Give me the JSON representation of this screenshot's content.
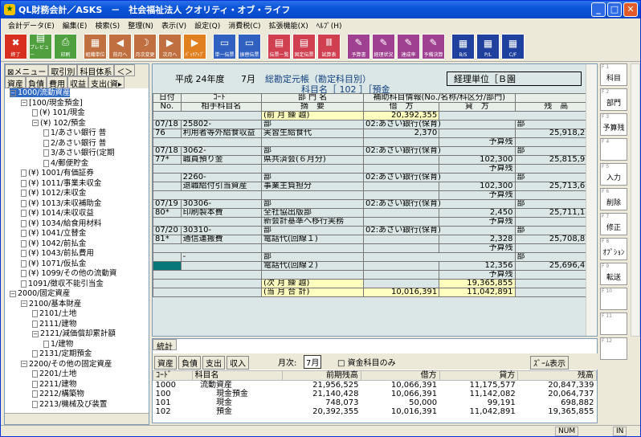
{
  "window": {
    "title": "QL財務会計／ASKS　－　社会福祉法人 クオリティ・オブ・ライフ"
  },
  "menu": [
    "会計データ(E)",
    "編集(E)",
    "検索(S)",
    "整理(N)",
    "表示(V)",
    "設定(Q)",
    "消費税(C)",
    "拡張機能(X)",
    "ﾍﾙﾌﾟ(H)"
  ],
  "toolbar": [
    {
      "label": "終了",
      "color": "#d83020",
      "icon": "exit-icon",
      "glyph": "✖"
    },
    {
      "label": "プレビュー",
      "color": "#50a040",
      "icon": "preview-icon",
      "glyph": "▤"
    },
    {
      "label": "印刷",
      "color": "#50a040",
      "icon": "print-icon",
      "glyph": "⎙"
    },
    {
      "label": "組織単位",
      "color": "#c07040",
      "icon": "org-icon",
      "glyph": "▦"
    },
    {
      "label": "前月へ",
      "color": "#c07040",
      "icon": "prev-month-icon",
      "glyph": "◀"
    },
    {
      "label": "月次変更",
      "color": "#c07040",
      "icon": "month-change-icon",
      "glyph": "☽"
    },
    {
      "label": "次月へ",
      "color": "#c07040",
      "icon": "next-month-icon",
      "glyph": "▶"
    },
    {
      "label": "ﾊﾞｯｸｱｯﾌﾟ",
      "color": "#e08020",
      "icon": "backup-icon",
      "glyph": "▶"
    },
    {
      "label": "単一伝票",
      "color": "#3060c0",
      "icon": "single-slip-icon",
      "glyph": "▭"
    },
    {
      "label": "振替伝票",
      "color": "#3060c0",
      "icon": "transfer-slip-icon",
      "glyph": "▭"
    },
    {
      "label": "伝票一覧",
      "color": "#d04050",
      "icon": "slip-list-icon",
      "glyph": "▤"
    },
    {
      "label": "固定伝票",
      "color": "#d04050",
      "icon": "fixed-slip-icon",
      "glyph": "▤"
    },
    {
      "label": "試算表",
      "color": "#d04050",
      "icon": "trial-balance-icon",
      "glyph": "Ⅲ"
    },
    {
      "label": "予算書",
      "color": "#a04090",
      "icon": "budget-icon",
      "glyph": "✎"
    },
    {
      "label": "経理状況",
      "color": "#a04090",
      "icon": "accounting-status-icon",
      "glyph": "✎"
    },
    {
      "label": "達成率",
      "color": "#a04090",
      "icon": "achievement-icon",
      "glyph": "✎"
    },
    {
      "label": "予備決算",
      "color": "#a04090",
      "icon": "pre-settlement-icon",
      "glyph": "✎"
    },
    {
      "label": "B/S",
      "color": "#2040a0",
      "icon": "bs-icon",
      "glyph": "▦"
    },
    {
      "label": "P/L",
      "color": "#2040a0",
      "icon": "pl-icon",
      "glyph": "▦"
    },
    {
      "label": "C/F",
      "color": "#2040a0",
      "icon": "cf-icon",
      "glyph": "▦"
    }
  ],
  "left_tabs": {
    "row1": [
      "⊠メニュー",
      "取引別",
      "科目体系",
      "＜＞"
    ],
    "row2": [
      "資産",
      "負債",
      "費用",
      "収益",
      "支出(資▸"
    ]
  },
  "tree": [
    {
      "t": "1000/流動資産",
      "d": 0,
      "k": "box",
      "s": true
    },
    {
      "t": "[100/現金預金]",
      "d": 1,
      "k": "box"
    },
    {
      "t": "(¥) 101/現金",
      "d": 2,
      "k": "doc"
    },
    {
      "t": "(¥) 102/預金",
      "d": 2,
      "k": "box"
    },
    {
      "t": "1/あさい銀行 普",
      "d": 3,
      "k": "doc"
    },
    {
      "t": "2/あさい銀行 普",
      "d": 3,
      "k": "doc"
    },
    {
      "t": "3/あさい銀行(定期",
      "d": 3,
      "k": "doc"
    },
    {
      "t": "4/郵便貯金",
      "d": 3,
      "k": "doc"
    },
    {
      "t": "(¥) 1001/有価証券",
      "d": 1,
      "k": "doc"
    },
    {
      "t": "(¥) 1011/事業未収金",
      "d": 1,
      "k": "doc"
    },
    {
      "t": "(¥) 1012/未収金",
      "d": 1,
      "k": "doc"
    },
    {
      "t": "(¥) 1013/未収補助金",
      "d": 1,
      "k": "doc"
    },
    {
      "t": "(¥) 1014/未収収益",
      "d": 1,
      "k": "doc"
    },
    {
      "t": "(¥) 1034/給食用材料",
      "d": 1,
      "k": "doc"
    },
    {
      "t": "(¥) 1041/立替金",
      "d": 1,
      "k": "doc"
    },
    {
      "t": "(¥) 1042/前払金",
      "d": 1,
      "k": "doc"
    },
    {
      "t": "(¥) 1043/前払費用",
      "d": 1,
      "k": "doc"
    },
    {
      "t": "(¥) 1071/仮払金",
      "d": 1,
      "k": "doc"
    },
    {
      "t": "(¥) 1099/その他の流動資",
      "d": 1,
      "k": "doc"
    },
    {
      "t": "1091/徴収不能引当金",
      "d": 1,
      "k": "doc"
    },
    {
      "t": "2000/固定資産",
      "d": 0,
      "k": "box"
    },
    {
      "t": "2100/基本財産",
      "d": 1,
      "k": "box"
    },
    {
      "t": "2101/土地",
      "d": 2,
      "k": "doc"
    },
    {
      "t": "2111/建物",
      "d": 2,
      "k": "doc"
    },
    {
      "t": "2121/減価償却累計額",
      "d": 2,
      "k": "box"
    },
    {
      "t": "1/建物",
      "d": 3,
      "k": "doc"
    },
    {
      "t": "2131/定期預金",
      "d": 2,
      "k": "doc"
    },
    {
      "t": "2200/その他の固定資産",
      "d": 1,
      "k": "box"
    },
    {
      "t": "2201/土地",
      "d": 2,
      "k": "doc"
    },
    {
      "t": "2211/建物",
      "d": 2,
      "k": "doc"
    },
    {
      "t": "2212/構築物",
      "d": 2,
      "k": "doc"
    },
    {
      "t": "2213/機械及び装置",
      "d": 2,
      "k": "doc"
    }
  ],
  "ledger": {
    "era": "平成 24年度",
    "month": "7月",
    "title": "総勘定元帳（勘定科目別）",
    "unit_label": "経理単位［Ｂ園",
    "account": "科目名［ 102 ］［預金",
    "headers": {
      "date": "日付",
      "code": "ｺｰﾄﾞ",
      "dept": "部 門 名",
      "sub": "補助科目情報(No./名称/科区分/部門)",
      "no": "No.",
      "acct": "相手科目名",
      "memo": "摘　要",
      "debit": "借　方",
      "credit": "貸　方",
      "balance": "残　高"
    },
    "carry": {
      "label": "(前 月 繰 越)",
      "amount": "20,392,355"
    },
    "rows": [
      {
        "date": "07/18",
        "code": "25802-",
        "no": "76",
        "acct": "利用者等外給食収益",
        "dept": "部",
        "sub": "02:あさい銀行(保育)",
        "memo": "実習生給食代",
        "debit": "2,370",
        "credit": "",
        "yosan": "予算残",
        "bal": "25,918,232"
      },
      {
        "date": "07/18",
        "code": "3062-",
        "no": "77*",
        "acct": "職員預り金",
        "dept": "部",
        "sub": "02:あさい銀行(保育)",
        "memo": "県共済会(６月分)",
        "debit": "",
        "credit": "102,300",
        "yosan": "予算残",
        "bal": "25,815,932"
      },
      {
        "date": "",
        "code": "2260-",
        "no": "",
        "acct": "退職給付引当資産",
        "dept": "部",
        "sub": "02:あさい銀行(保育)",
        "memo": "事業主負担分",
        "debit": "",
        "credit": "102,300",
        "yosan": "予算残",
        "bal": "25,713,632"
      },
      {
        "date": "07/19",
        "code": "30306-",
        "no": "80*",
        "acct": "印刷製本費",
        "dept": "部",
        "sub": "02:あさい銀行(保育)",
        "memo": "全社協出版部",
        "memo2": "新会計基準へ移行実務",
        "debit": "",
        "credit": "2,450",
        "yosan": "予算残",
        "bal": "25,711,182"
      },
      {
        "date": "07/20",
        "code": "30310-",
        "no": "81*",
        "acct": "通信運搬費",
        "dept": "部",
        "sub": "02:あさい銀行(保育)",
        "memo": "電話代(回線１)",
        "debit": "",
        "credit": "2,328",
        "yosan": "予算残",
        "bal": "25,708,854"
      },
      {
        "date": "",
        "code": "-",
        "no": "",
        "acct": "",
        "dept": "部",
        "sub": "",
        "memo": "電話代(回線２)",
        "debit": "",
        "credit": "12,356",
        "yosan": "予算残",
        "bal": "25,696,498"
      }
    ],
    "next": {
      "label": "(次 月 繰 越)",
      "amount": "19,365,855"
    },
    "total": {
      "label": "(当 月 合 計)",
      "debit": "10,016,391",
      "credit": "11,042,891"
    }
  },
  "fkeys": [
    {
      "n": "F 1",
      "l": "科目"
    },
    {
      "n": "F 2",
      "l": "部門"
    },
    {
      "n": "F 3",
      "l": "予算残"
    },
    {
      "n": "F 4",
      "l": ""
    },
    {
      "n": "F 5",
      "l": "入力"
    },
    {
      "n": "F 6",
      "l": "削除"
    },
    {
      "n": "F 7",
      "l": "修正"
    },
    {
      "n": "F 8",
      "l": "ｵﾌﾟｼｮﾝ"
    },
    {
      "n": "F 9",
      "l": "転送"
    },
    {
      "n": "F 10",
      "l": ""
    },
    {
      "n": "F 11",
      "l": ""
    },
    {
      "n": "F 12",
      "l": ""
    }
  ],
  "bottom": {
    "tab": "統計",
    "tabs": [
      "資産",
      "負債",
      "支出",
      "収入"
    ],
    "month_label": "月次:",
    "month": "7月",
    "checkbox": "資金科目のみ",
    "zoom": "ｽﾞｰﾑ表示",
    "headers": [
      "ｺｰﾄﾞ",
      "科目名",
      "前期残高",
      "借方",
      "貸方",
      "残高"
    ],
    "rows": [
      [
        "1000",
        "流動資産",
        "21,956,525",
        "10,066,391",
        "11,175,577",
        "20,847,339"
      ],
      [
        "100",
        "現金預金",
        "21,140,428",
        "10,066,391",
        "11,142,082",
        "20,064,737"
      ],
      [
        "101",
        "現金",
        "748,073",
        "50,000",
        "99,191",
        "698,882"
      ],
      [
        "102",
        "預金",
        "20,392,355",
        "10,016,391",
        "11,042,891",
        "19,365,855"
      ]
    ]
  },
  "status": {
    "num": "NUM",
    "in": "IN"
  }
}
